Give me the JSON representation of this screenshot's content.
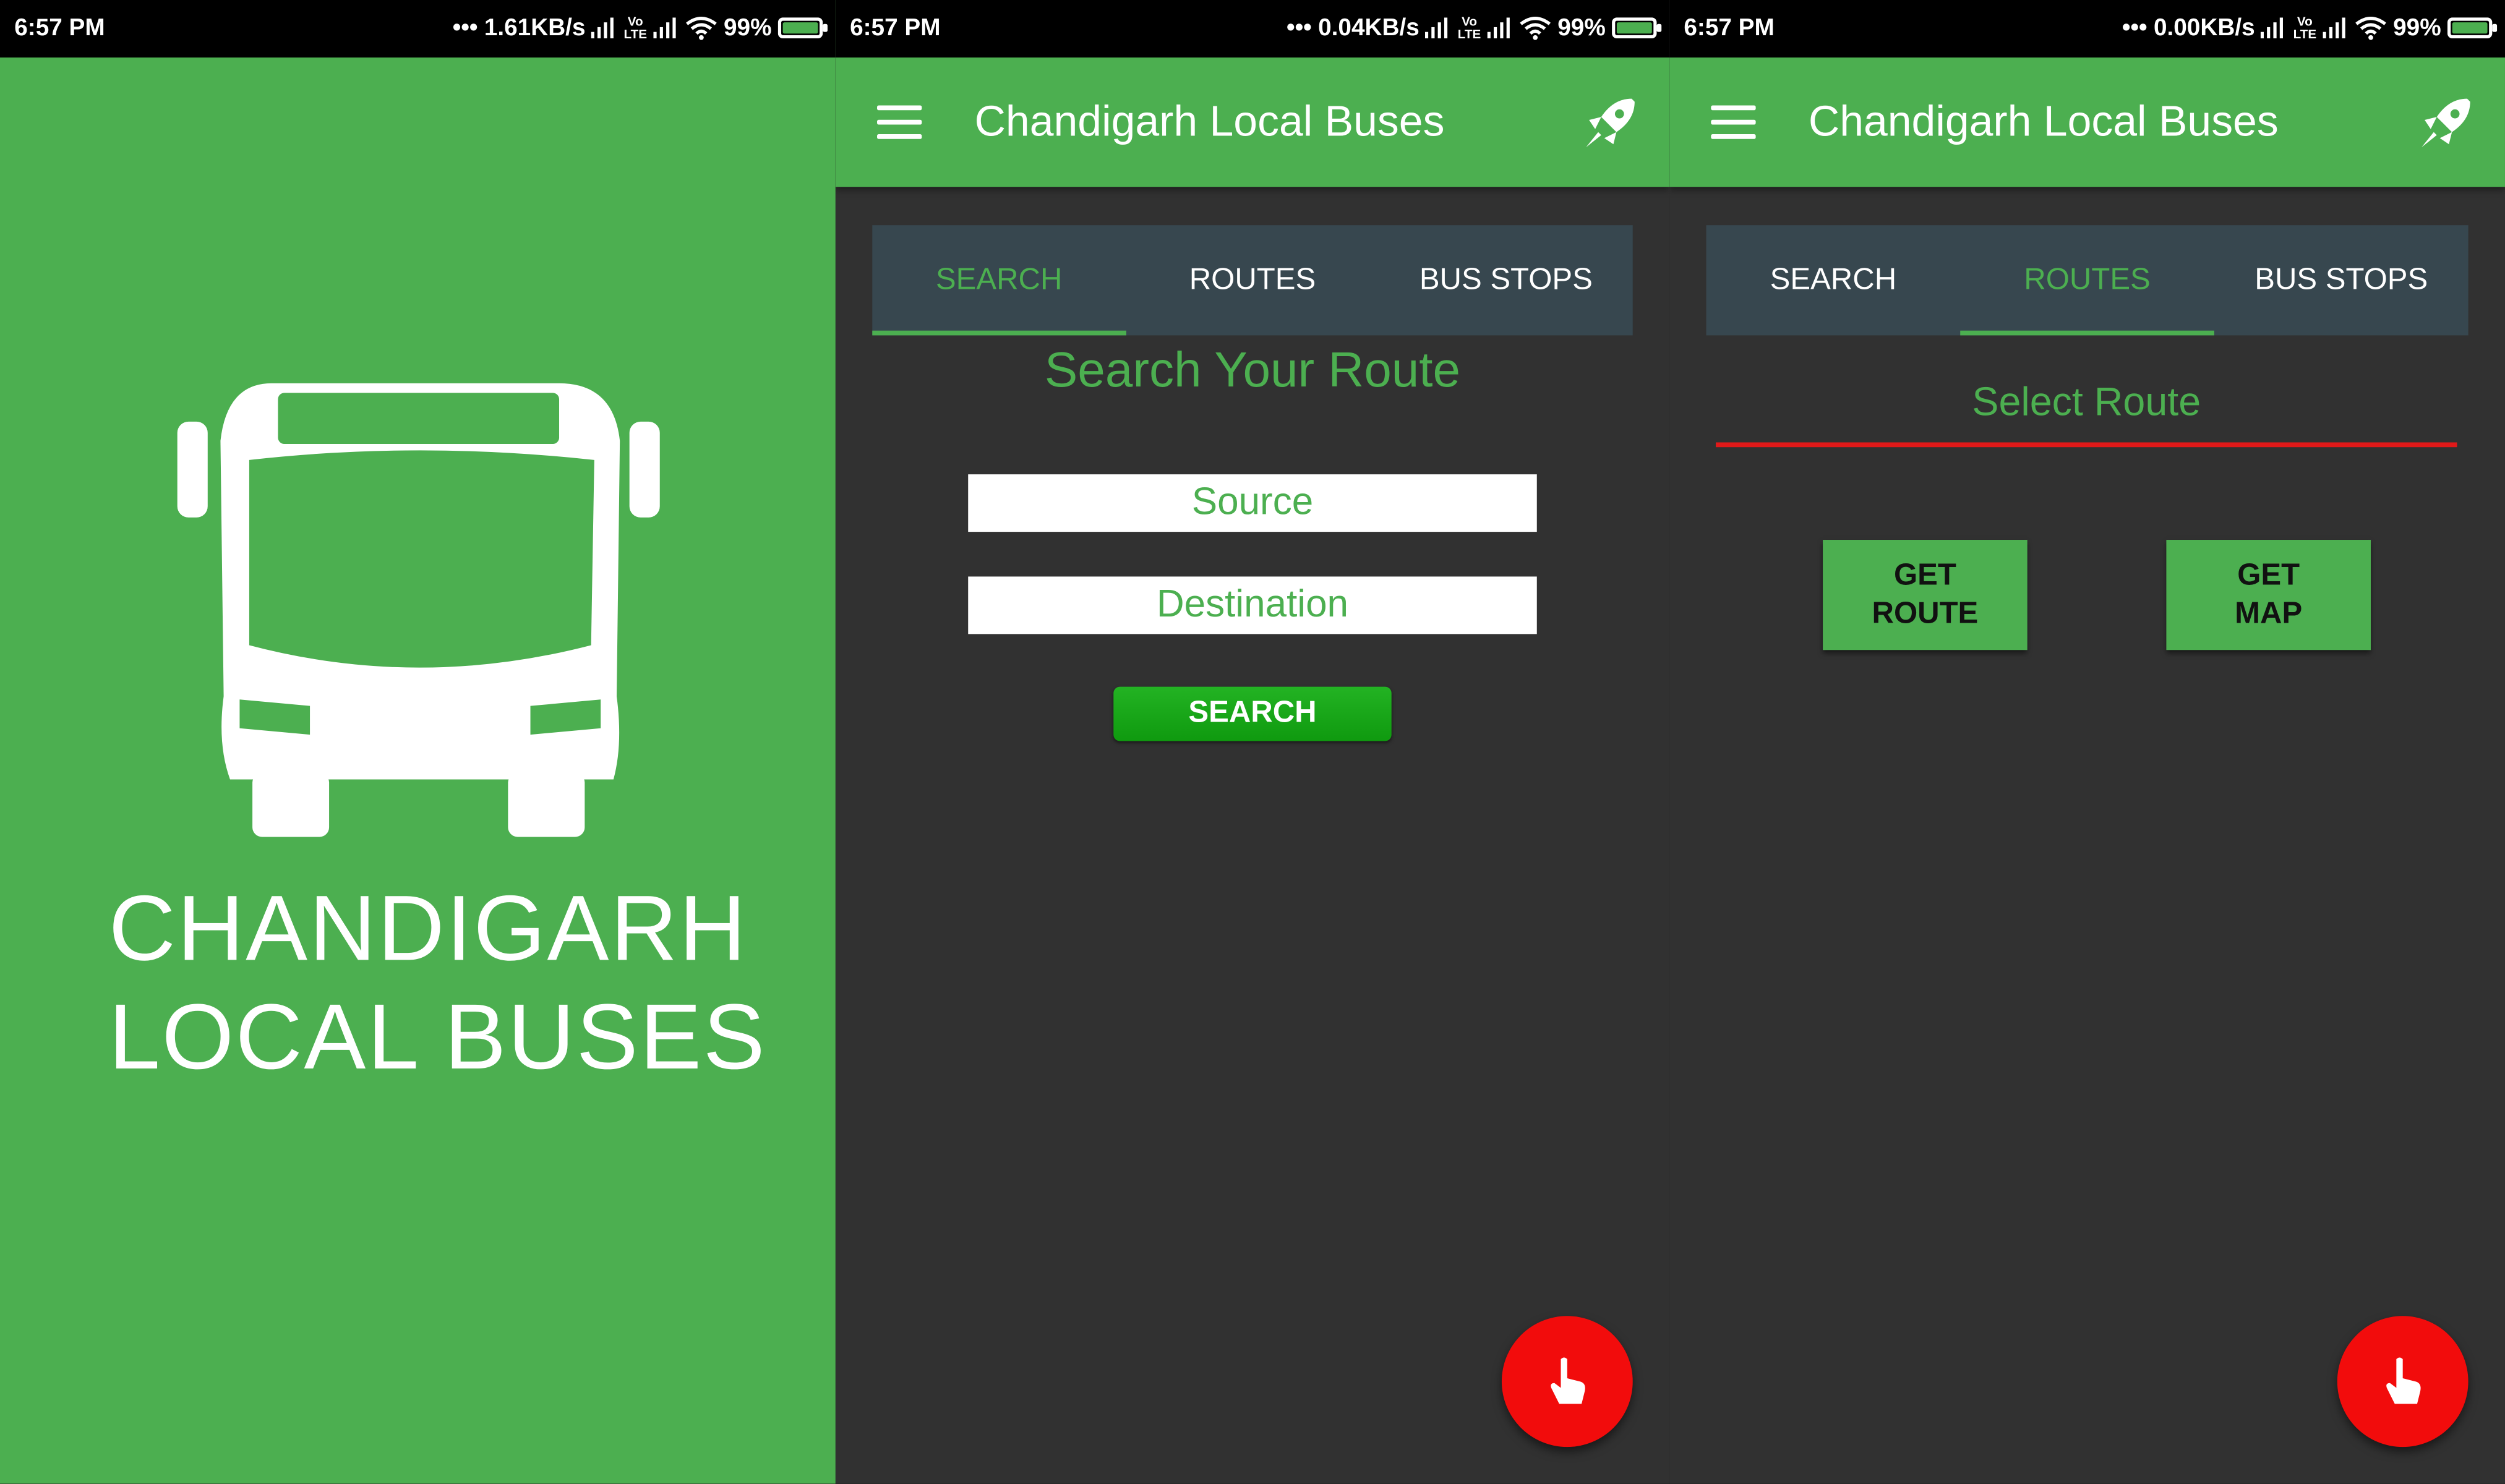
{
  "colors": {
    "brand_green": "#4caf50",
    "dark_background": "#313131",
    "tab_bar": "#37474f",
    "fab_red": "#f20c0c",
    "underline_red": "#e01919"
  },
  "screens": [
    {
      "status": {
        "time": "6:57 PM",
        "speed": "1.61KB/s",
        "battery": "99%"
      },
      "splash": {
        "title_line1": "CHANDIGARH",
        "title_line2": "LOCAL BUSES",
        "logo_icon": "bus-icon"
      }
    },
    {
      "status": {
        "time": "6:57 PM",
        "speed": "0.04KB/s",
        "battery": "99%"
      },
      "appbar": {
        "title": "Chandigarh Local Buses",
        "menu_icon": "hamburger-menu-icon",
        "action_icon": "rocket-icon"
      },
      "tabs": [
        {
          "label": "SEARCH",
          "active": true
        },
        {
          "label": "ROUTES",
          "active": false
        },
        {
          "label": "BUS STOPS",
          "active": false
        }
      ],
      "search": {
        "heading": "Search Your Route",
        "source_placeholder": "Source",
        "destination_placeholder": "Destination",
        "button_label": "SEARCH"
      },
      "fab_icon": "hand-pointer-icon"
    },
    {
      "status": {
        "time": "6:57 PM",
        "speed": "0.00KB/s",
        "battery": "99%"
      },
      "appbar": {
        "title": "Chandigarh Local Buses",
        "menu_icon": "hamburger-menu-icon",
        "action_icon": "rocket-icon"
      },
      "tabs": [
        {
          "label": "SEARCH",
          "active": false
        },
        {
          "label": "ROUTES",
          "active": true
        },
        {
          "label": "BUS STOPS",
          "active": false
        }
      ],
      "routes": {
        "select_label": "Select Route",
        "get_route_line1": "GET",
        "get_route_line2": "ROUTE",
        "get_map_line1": "GET",
        "get_map_line2": "MAP"
      },
      "fab_icon": "hand-pointer-icon"
    }
  ]
}
